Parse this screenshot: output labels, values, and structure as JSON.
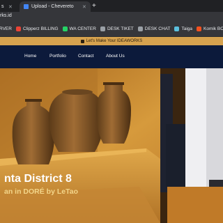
{
  "browser": {
    "tabs": [
      {
        "title": "s"
      },
      {
        "title": "Upload - Chevereto"
      }
    ],
    "url": "rks.id"
  },
  "bookmarks": [
    {
      "label": "RVER",
      "color": "#8ab4f8"
    },
    {
      "label": "Clipperz BILLING",
      "color": "#ea4335"
    },
    {
      "label": "WA CENTER",
      "color": "#25d366"
    },
    {
      "label": "DESK TIKET",
      "color": "#9aa0a6"
    },
    {
      "label": "DESK CHAT",
      "color": "#9aa0a6"
    },
    {
      "label": "Taiga",
      "color": "#5bc0de"
    },
    {
      "label": "Komik BCU",
      "color": "#f4511e"
    }
  ],
  "site": {
    "announcement": "Let's Make Your IDEAWORKS",
    "nav": [
      "Home",
      "Portfolio",
      "Contact",
      "About Us"
    ],
    "hero": {
      "title": "nta District 8",
      "subtitle": "an in DORÉ by LeTao"
    }
  },
  "colors": {
    "announce_bg": "#d6a24e",
    "nav_bg": "#0c1a3b",
    "hero_wall": "#c8892e",
    "subtitle": "#f3d58a"
  }
}
